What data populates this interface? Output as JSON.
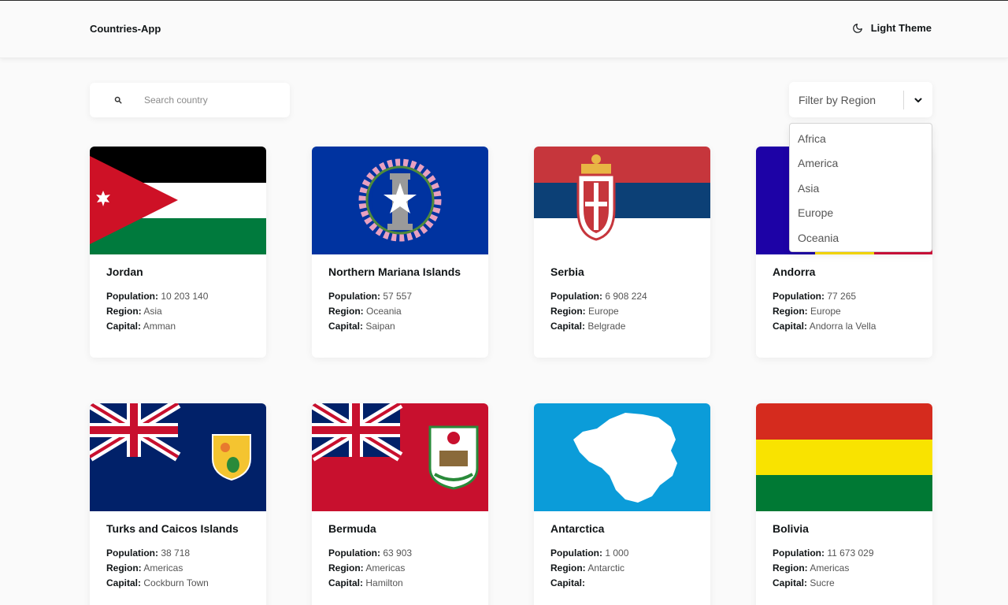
{
  "app": {
    "title": "Countries-App"
  },
  "theme_toggle": {
    "label": "Light Theme",
    "icon": "moon-icon"
  },
  "search": {
    "placeholder": "Search country",
    "value": "",
    "icon": "search-icon"
  },
  "filter": {
    "label": "Filter by Region",
    "icon": "chevron-down-icon",
    "options": [
      "Africa",
      "America",
      "Asia",
      "Europe",
      "Oceania"
    ]
  },
  "labels": {
    "population": "Population:",
    "region": "Region:",
    "capital": "Capital:"
  },
  "countries": [
    {
      "name": "Jordan",
      "population": "10 203 140",
      "region": "Asia",
      "capital": "Amman",
      "flag": "jordan-flag"
    },
    {
      "name": "Northern Mariana Islands",
      "population": "57 557",
      "region": "Oceania",
      "capital": "Saipan",
      "flag": "northern-mariana-islands-flag"
    },
    {
      "name": "Serbia",
      "population": "6 908 224",
      "region": "Europe",
      "capital": "Belgrade",
      "flag": "serbia-flag"
    },
    {
      "name": "Andorra",
      "population": "77 265",
      "region": "Europe",
      "capital": "Andorra la Vella",
      "flag": "andorra-flag"
    },
    {
      "name": "Turks and Caicos Islands",
      "population": "38 718",
      "region": "Americas",
      "capital": "Cockburn Town",
      "flag": "turks-and-caicos-flag"
    },
    {
      "name": "Bermuda",
      "population": "63 903",
      "region": "Americas",
      "capital": "Hamilton",
      "flag": "bermuda-flag"
    },
    {
      "name": "Antarctica",
      "population": "1 000",
      "region": "Antarctic",
      "capital": "",
      "flag": "antarctica-flag"
    },
    {
      "name": "Bolivia",
      "population": "11 673 029",
      "region": "Americas",
      "capital": "Sucre",
      "flag": "bolivia-flag"
    }
  ],
  "colors": {
    "background": "#fafafa",
    "element": "#ffffff",
    "text": "#111517",
    "muted": "#555555"
  }
}
